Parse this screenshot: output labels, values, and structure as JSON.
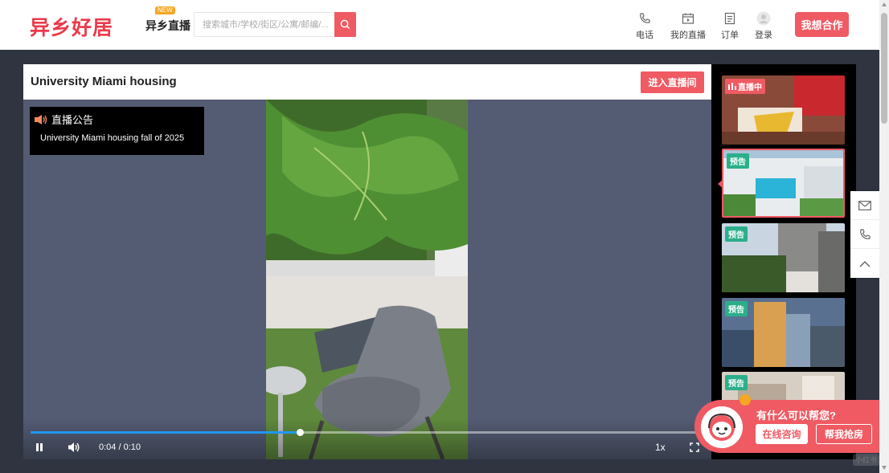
{
  "header": {
    "logo": "异乡好居",
    "live_label": "异乡直播",
    "new_badge": "NEW",
    "search_placeholder": "搜索城市/学校/街区/公寓/邮编/...",
    "nav": [
      {
        "label": "电话",
        "icon": "phone-icon"
      },
      {
        "label": "我的直播",
        "icon": "live-calendar-icon"
      },
      {
        "label": "订单",
        "icon": "order-icon"
      },
      {
        "label": "登录",
        "icon": "user-icon"
      }
    ],
    "cooperate_label": "我想合作"
  },
  "player": {
    "title": "University Miami housing",
    "enter_label": "进入直播间",
    "notice_title": "直播公告",
    "notice_text": "University Miami housing fall of 2025",
    "current_time": "0:04",
    "duration": "0:10",
    "time_display": "0:04 / 0:10",
    "progress": 0.4,
    "speed": "1x"
  },
  "sidebar": {
    "items": [
      {
        "badge": "直播中",
        "kind": "live"
      },
      {
        "badge": "预告",
        "kind": "preview"
      },
      {
        "badge": "预告",
        "kind": "preview"
      },
      {
        "badge": "预告",
        "kind": "preview"
      },
      {
        "badge": "预告",
        "kind": "preview"
      }
    ]
  },
  "help": {
    "question": "有什么可以帮您?",
    "consult_label": "在线咨询",
    "grab_label": "帮我抢房"
  },
  "watermark": "小红书",
  "colors": {
    "accent": "#ef5a63",
    "preview": "#2baf8a",
    "progress": "#2196f3"
  }
}
